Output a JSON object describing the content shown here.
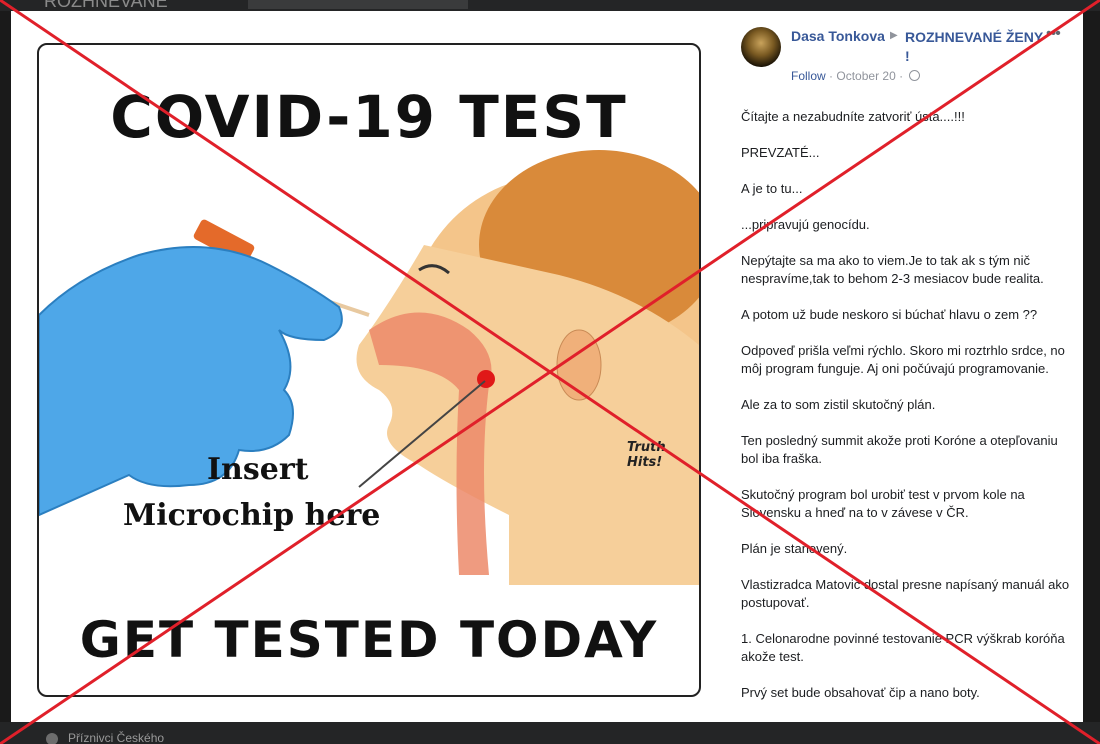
{
  "background": {
    "top_ghost_title": "ROZHNEVANÉ",
    "bottom_ghost_link": "Příznivci Českého"
  },
  "image": {
    "title": "COVID-19 TEST",
    "insert_line1": "Insert",
    "insert_line2": "Microchip here",
    "footer": "GET TESTED TODAY",
    "watermark_line1": "Truth",
    "watermark_line2": "Hits!"
  },
  "post": {
    "author": "Dasa Tonkova",
    "group": "ROZHNEVANÉ ŽENY !",
    "follow": "Follow",
    "date": "October 20",
    "separator": "·",
    "more": "•••",
    "paragraphs": [
      "Čítajte a nezabudníte zatvoriť ústa....!!!",
      "PREVZATÉ...",
      "A je to tu...",
      "...pripravujú genocídu.",
      "Nepýtajte sa ma ako to viem.Je to tak ak s tým nič nespravíme,tak to behom 2-3 mesiacov bude realita.",
      "A potom už bude neskoro si búchať hlavu o zem ??",
      "Odpoveď prišla veľmi rýchlo. Skoro mi roztrhlo srdce, no môj program funguje. Aj oni počúvajú programovanie.",
      "Ale za to som zistil skutočný plán.",
      "Ten posledný summit akože proti Koróne a otepľovaniu bol iba fraška.",
      "Skutočný program bol urobiť test v prvom kole na Slovensku a hneď na to v závese v ČR.",
      "Plán je stanovený.",
      "Vlastizradca Matovič dostal presne napísaný manuál ako postupovať.",
      "1. Celonarodne povinné testovanie PCR výškrab koróňa akože test.",
      "Prvý set bude obsahovať čip a nano boty."
    ]
  },
  "colors": {
    "facebook_blue": "#385898",
    "cross_red": "#e0202a",
    "glove_blue": "#4ea7e8"
  }
}
